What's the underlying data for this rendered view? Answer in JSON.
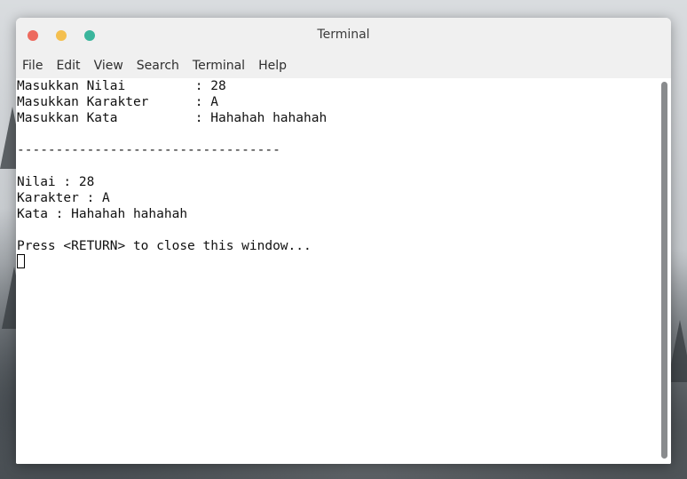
{
  "window": {
    "title": "Terminal"
  },
  "menu": {
    "items": [
      "File",
      "Edit",
      "View",
      "Search",
      "Terminal",
      "Help"
    ]
  },
  "terminal": {
    "lines": [
      "Masukkan Nilai         : 28",
      "Masukkan Karakter      : A",
      "Masukkan Kata          : Hahahah hahahah",
      "",
      "----------------------------------",
      "",
      "Nilai : 28",
      "Karakter : A",
      "Kata : Hahahah hahahah",
      "",
      "Press <RETURN> to close this window..."
    ]
  },
  "colors": {
    "close": "#ed6a5e",
    "minimize": "#f4bf4f",
    "maximize": "#3ab59c"
  }
}
